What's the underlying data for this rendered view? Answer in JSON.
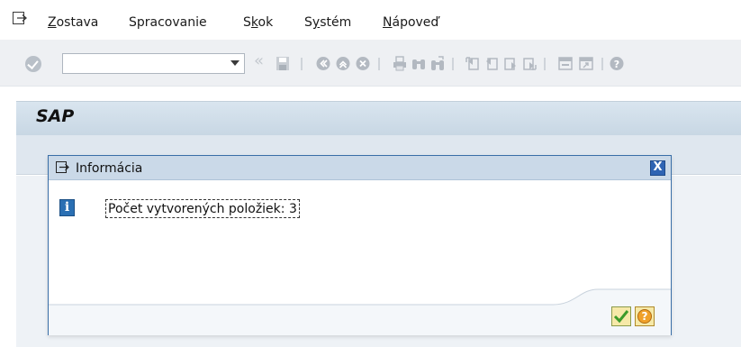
{
  "menu": {
    "items": [
      {
        "pre": "",
        "u": "Z",
        "post": "ostava"
      },
      {
        "pre": "Spracovanie",
        "u": "",
        "post": ""
      },
      {
        "pre": "S",
        "u": "k",
        "post": "ok"
      },
      {
        "pre": "S",
        "u": "y",
        "post": "stém"
      },
      {
        "pre": "",
        "u": "N",
        "post": "ápoveď"
      }
    ]
  },
  "toolbar": {
    "command_value": "",
    "nav_glyph": "«"
  },
  "screen": {
    "title": "SAP"
  },
  "dialog": {
    "title": "Informácia",
    "close_glyph": "X",
    "message": "Počet vytvorených položiek: 3",
    "info_glyph": "i",
    "help_glyph": "?"
  },
  "colors": {
    "accent_blue": "#2f64b3",
    "dialog_title_bg": "#cad9e8",
    "confirm_check": "#3c9b2a",
    "help_orange": "#f0a12a"
  }
}
